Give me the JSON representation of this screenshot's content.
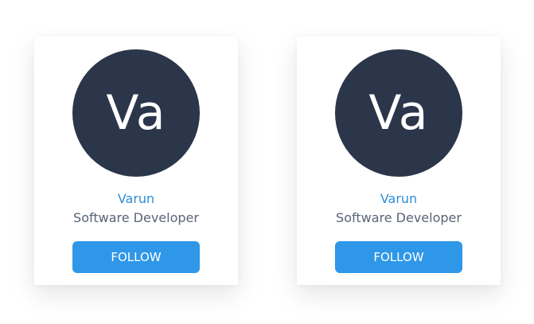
{
  "cards": [
    {
      "avatar_text": "Va",
      "name": "Varun",
      "role": "Software Developer",
      "button_label": "FOLLOW"
    },
    {
      "avatar_text": "Va",
      "name": "Varun",
      "role": "Software Developer",
      "button_label": "FOLLOW"
    }
  ],
  "colors": {
    "avatar_bg": "#2b364b",
    "name": "#2d8fd7",
    "role": "#5a6475",
    "button_bg": "#2e97e8",
    "button_text": "#ffffff"
  }
}
